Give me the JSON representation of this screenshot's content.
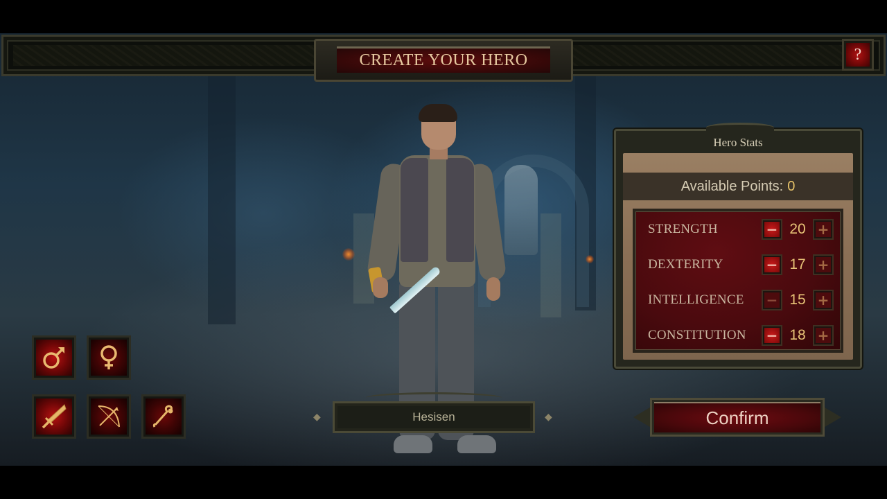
{
  "title": "CREATE YOUR HERO",
  "help_button": {
    "label": "?"
  },
  "hero_stats": {
    "header": "Hero Stats",
    "available_points_label": "Available Points:",
    "available_points": "0",
    "stats": [
      {
        "name": "STRENGTH",
        "value": "20",
        "minus_enabled": true
      },
      {
        "name": "DEXTERITY",
        "value": "17",
        "minus_enabled": true
      },
      {
        "name": "INTELLIGENCE",
        "value": "15",
        "minus_enabled": false
      },
      {
        "name": "CONSTITUTION",
        "value": "18",
        "minus_enabled": true
      }
    ],
    "minus_label": "−",
    "plus_label": "+"
  },
  "gender_options": [
    {
      "id": "male",
      "icon": "male-symbol-icon",
      "selected": true
    },
    {
      "id": "female",
      "icon": "female-symbol-icon",
      "selected": false
    }
  ],
  "class_options": [
    {
      "id": "warrior",
      "icon": "sword-icon",
      "selected": true
    },
    {
      "id": "archer",
      "icon": "bow-arrow-icon",
      "selected": false
    },
    {
      "id": "mage",
      "icon": "staff-icon",
      "selected": false
    }
  ],
  "hero_name": "Hesisen",
  "confirm_button": {
    "label": "Confirm"
  },
  "colors": {
    "accent_red": "#7c0909",
    "gold_text": "#e7c377",
    "frame": "#4a4a38"
  }
}
